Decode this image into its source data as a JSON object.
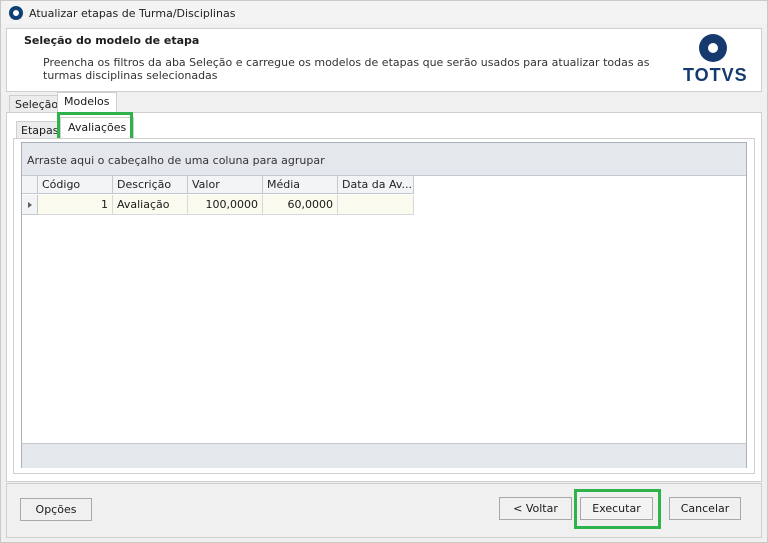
{
  "window": {
    "title": "Atualizar etapas de Turma/Disciplinas"
  },
  "header": {
    "title": "Seleção do modelo de etapa",
    "description": "Preencha os filtros da aba Seleção e carregue os modelos de etapas que serão usados para atualizar todas as turmas disciplinas selecionadas",
    "logo_text": "TOTVS"
  },
  "outer_tabs": [
    {
      "label": "Seleção"
    },
    {
      "label": "Modelos"
    }
  ],
  "inner_tabs": [
    {
      "label": "Etapas"
    },
    {
      "label": "Avaliações"
    }
  ],
  "grid": {
    "group_hint": "Arraste aqui o cabeçalho de uma coluna para agrupar",
    "columns": [
      "Código",
      "Descrição",
      "Valor",
      "Média",
      "Data da Av..."
    ],
    "rows": [
      {
        "codigo": "1",
        "descricao": "Avaliação",
        "valor": "100,0000",
        "media": "60,0000",
        "data": ""
      }
    ]
  },
  "buttons": {
    "options": "Opções",
    "back": "< Voltar",
    "execute": "Executar",
    "cancel": "Cancelar"
  },
  "highlight_color": "#2fb14c"
}
